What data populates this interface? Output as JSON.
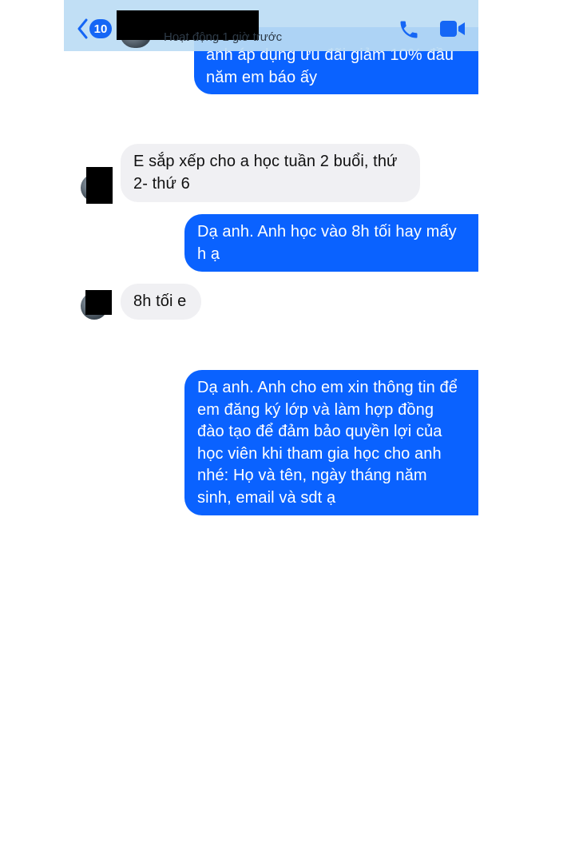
{
  "header": {
    "unread_count": "10",
    "status": "Hoạt động 1 giờ trước",
    "accent_color": "#0a62ff"
  },
  "messages": [
    {
      "from": "me",
      "lines": [
        "anh áp dụng ưu đãi giảm 10% đầu",
        "năm em báo ấy"
      ]
    },
    {
      "from": "other",
      "lines": [
        "E sắp xếp cho a học tuần 2 buổi, thứ",
        "2- thứ 6"
      ]
    },
    {
      "from": "me",
      "lines": [
        "Dạ anh. Anh học vào 8h tối hay mấy",
        "h ạ"
      ]
    },
    {
      "from": "other",
      "lines": [
        "8h tối e"
      ]
    },
    {
      "from": "me",
      "lines": [
        "Dạ anh. Anh cho em xin thông tin để",
        "em đăng ký lớp và làm hợp đồng",
        "đào tạo để đảm bảo quyền lợi của",
        "học viên khi tham gia học cho anh",
        "nhé: Họ và tên, ngày tháng năm",
        "sinh, email và sdt ạ"
      ]
    }
  ],
  "icons": {
    "back": "chevron-left-icon",
    "call": "phone-icon",
    "video": "video-camera-icon"
  }
}
